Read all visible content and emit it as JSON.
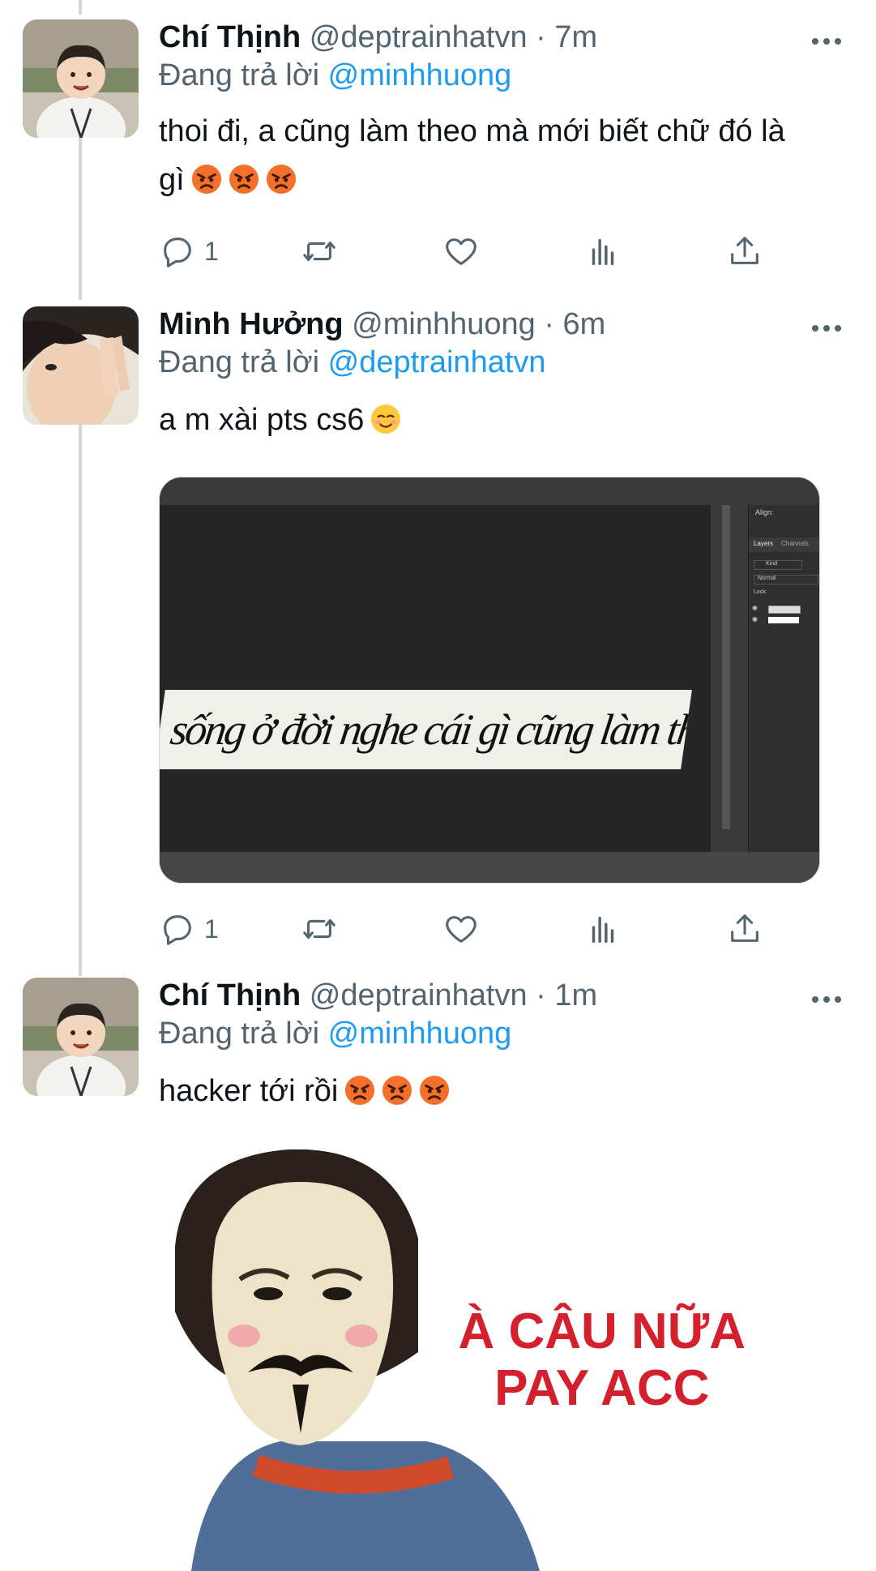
{
  "tweets": [
    {
      "name": "Chí Thịnh",
      "handle": "@deptrainhatvn",
      "time": "7m",
      "reply_prefix": "Đang trả lời",
      "reply_to": "@minhhuong",
      "text_line1": "thoi đi, a cũng làm theo mà mới biết chữ đó là",
      "text_line2": "gì",
      "emojis": [
        "angry-face",
        "angry-face",
        "angry-face"
      ],
      "reply_count": "1"
    },
    {
      "name": "Minh Hưởng",
      "handle": "@minhhuong",
      "time": "6m",
      "reply_prefix": "Đang trả lời",
      "reply_to": "@deptrainhatvn",
      "text": "a m xài pts cs6",
      "emojis": [
        "smiling-face"
      ],
      "reply_count": "1",
      "media": {
        "canvas_text": "sống ở đời nghe cái gì cũng làm theo vậy",
        "panel_align_label": "Align:",
        "panel_tabs": [
          "Layers",
          "Channels"
        ],
        "panel_kind": "Kind",
        "panel_blend": "Normal",
        "panel_lock": "Lock:"
      }
    },
    {
      "name": "Chí Thịnh",
      "handle": "@deptrainhatvn",
      "time": "1m",
      "reply_prefix": "Đang trả lời",
      "reply_to": "@minhhuong",
      "text": "hacker tới rồi",
      "emojis": [
        "angry-face",
        "angry-face",
        "angry-face"
      ],
      "media": {
        "meme_line1": "À CÂU NỮA",
        "meme_line2": "PAY ACC"
      }
    }
  ],
  "separator": "·",
  "colors": {
    "accent": "#1d9bf0",
    "secondary_text": "#536471",
    "thread_line": "#cfd9de"
  }
}
